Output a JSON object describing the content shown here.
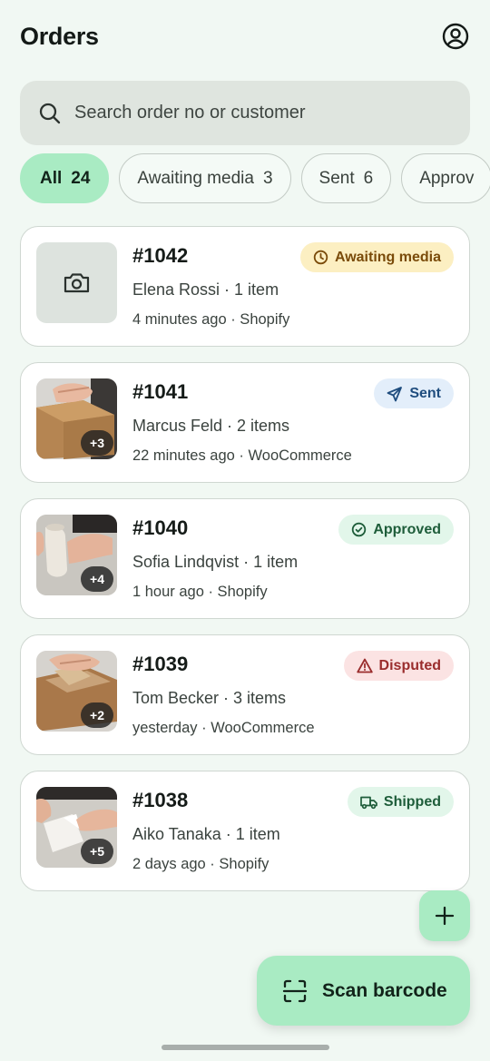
{
  "header": {
    "title": "Orders",
    "profile_icon": "account-circle-icon"
  },
  "search": {
    "placeholder": "Search order no or customer",
    "value": ""
  },
  "filters": [
    {
      "label": "All",
      "count": "24",
      "active": true
    },
    {
      "label": "Awaiting media",
      "count": "3",
      "active": false
    },
    {
      "label": "Sent",
      "count": "6",
      "active": false
    },
    {
      "label": "Approv",
      "count": "",
      "active": false
    }
  ],
  "orders": [
    {
      "number": "#1042",
      "customer": "Elena Rossi · 1 item",
      "meta": "4 minutes ago · Shopify",
      "status": "Awaiting media",
      "status_icon": "clock-icon",
      "extra_media": "",
      "thumb": "camera-placeholder"
    },
    {
      "number": "#1041",
      "customer": "Marcus Feld · 2 items",
      "meta": "22 minutes ago · WooCommerce",
      "status": "Sent",
      "status_icon": "send-icon",
      "extra_media": "+3",
      "thumb": "box-photo"
    },
    {
      "number": "#1040",
      "customer": "Sofia Lindqvist · 1 item",
      "meta": "1 hour ago · Shopify",
      "status": "Approved",
      "status_icon": "check-circle-icon",
      "extra_media": "+4",
      "thumb": "vase-photo"
    },
    {
      "number": "#1039",
      "customer": "Tom Becker · 3 items",
      "meta": "yesterday · WooCommerce",
      "status": "Disputed",
      "status_icon": "warning-icon",
      "extra_media": "+2",
      "thumb": "packing-photo"
    },
    {
      "number": "#1038",
      "customer": "Aiko Tanaka · 1 item",
      "meta": "2 days ago · Shopify",
      "status": "Shipped",
      "status_icon": "truck-icon",
      "extra_media": "+5",
      "thumb": "wrapping-photo"
    }
  ],
  "actions": {
    "add_icon": "plus-icon",
    "scan_label": "Scan barcode",
    "scan_icon": "scan-barcode-icon"
  },
  "colors": {
    "accent": "#a9ebc3",
    "background": "#f1f8f3",
    "awaiting": "#fcefc2",
    "sent": "#e3eefa",
    "approved": "#e2f6ea",
    "disputed": "#fbe3e3"
  }
}
